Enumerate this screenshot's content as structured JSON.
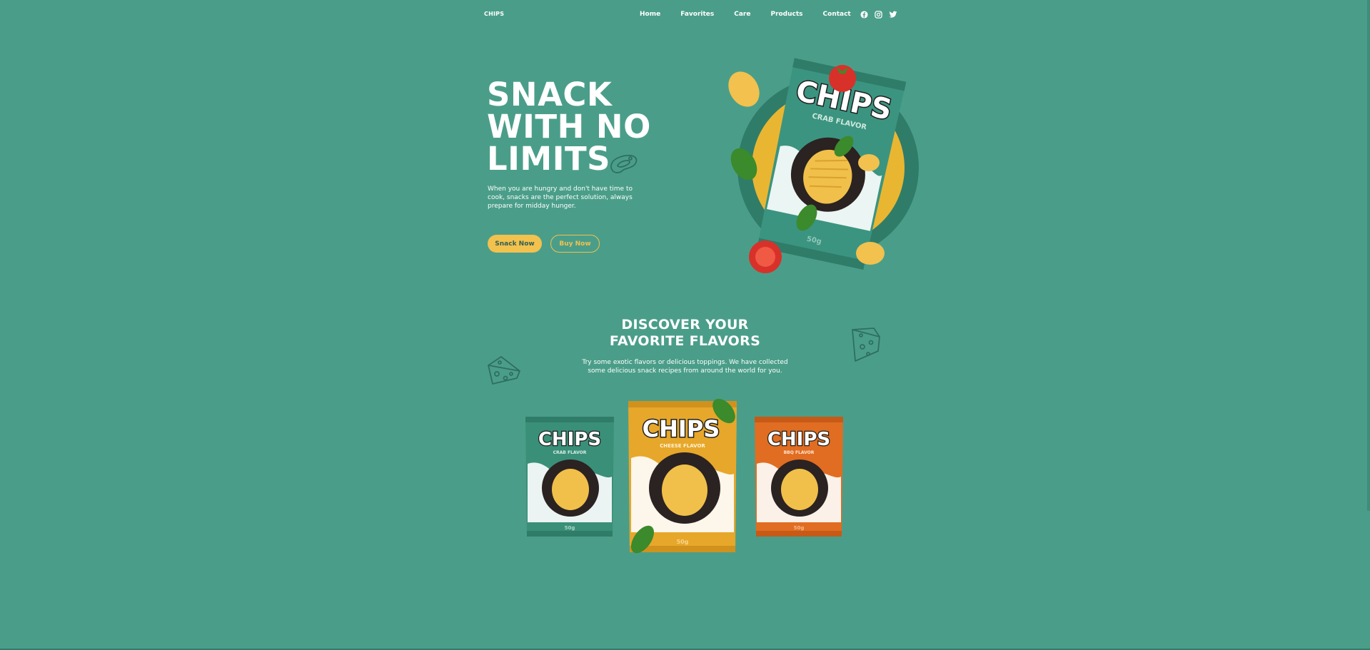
{
  "brand": {
    "logo": "CHIPS"
  },
  "nav": {
    "items": [
      "Home",
      "Favorites",
      "Care",
      "Products",
      "Contact"
    ],
    "social": [
      "facebook-icon",
      "instagram-icon",
      "twitter-icon"
    ]
  },
  "hero": {
    "title_lines": [
      "SNACK",
      "WITH NO",
      "LIMITS"
    ],
    "description": "When you are hungry and don't have time to cook, snacks are the perfect solution, always prepare for midday hunger.",
    "primary_button": "Snack Now",
    "secondary_button": "Buy Now",
    "product": {
      "brand": "CHIPS",
      "flavor": "CRAB FLAVOR",
      "weight": "50g"
    }
  },
  "discover": {
    "title_lines": [
      "DISCOVER YOUR",
      "FAVORITE FLAVORS"
    ],
    "description_lines": [
      "Try some exotic flavors or delicious toppings. We have collected",
      "some delicious snack recipes from around the world for you."
    ],
    "products": [
      {
        "brand": "CHIPS",
        "flavor": "CRAB FLAVOR",
        "weight": "50g",
        "color": "#3a8f78"
      },
      {
        "brand": "CHIPS",
        "flavor": "CHEESE FLAVOR",
        "weight": "50g",
        "color": "#e7a72a"
      },
      {
        "brand": "CHIPS",
        "flavor": "BBQ FLAVOR",
        "weight": "50g",
        "color": "#e06d22"
      }
    ]
  },
  "colors": {
    "background": "#4a9e89",
    "accent": "#f2c14e",
    "text": "#ffffff"
  }
}
